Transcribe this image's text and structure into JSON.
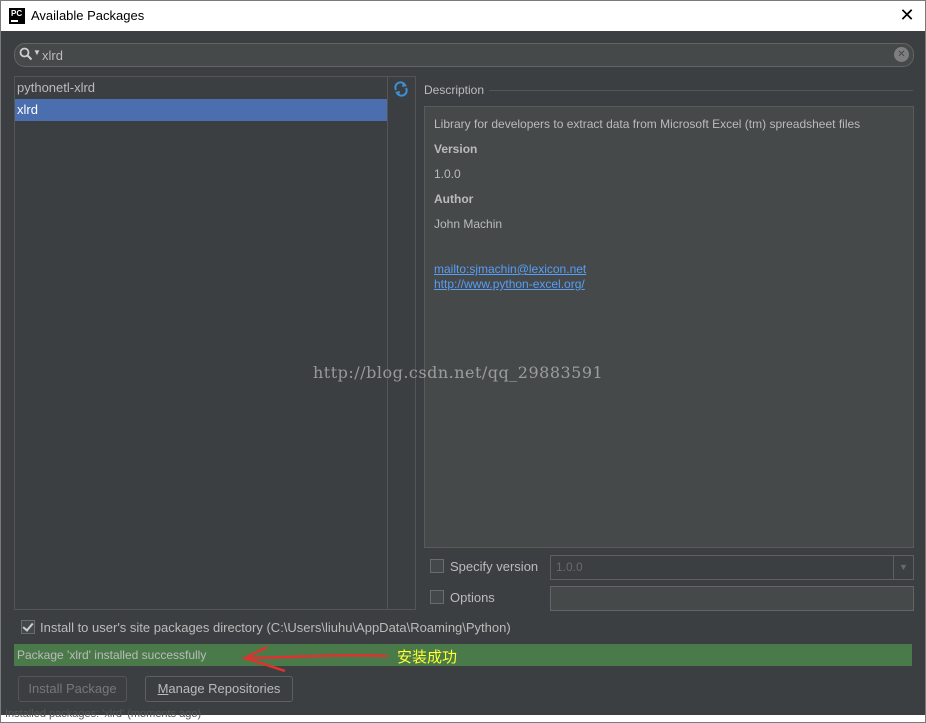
{
  "window": {
    "title": "Available Packages",
    "app_icon_text": "PC"
  },
  "search": {
    "value": "xlrd"
  },
  "packages": [
    {
      "name": "pythonetl-xlrd",
      "selected": false
    },
    {
      "name": "xlrd",
      "selected": true
    }
  ],
  "description": {
    "label": "Description",
    "summary": "Library for developers to extract data from Microsoft Excel (tm) spreadsheet files",
    "version_label": "Version",
    "version_value": "1.0.0",
    "author_label": "Author",
    "author_value": "John Machin",
    "mailto_link": "mailto:sjmachin@lexicon.net",
    "home_link": "http://www.python-excel.org/"
  },
  "options": {
    "specify_version_label": "Specify version",
    "specify_version_checked": false,
    "version_selected": "1.0.0",
    "options_label": "Options",
    "options_checked": false,
    "options_value": ""
  },
  "install_to_user": {
    "label": "Install to user's site packages directory (C:\\Users\\liuhu\\AppData\\Roaming\\Python)",
    "checked": true
  },
  "status": {
    "message": "Package 'xlrd' installed successfully",
    "annotation": "安装成功",
    "color": "#4a7a4a"
  },
  "buttons": {
    "install_label": "Install Package",
    "manage_label_mnemonic": "M",
    "manage_label_rest": "anage Repositories"
  },
  "watermark": "http://blog.csdn.net/qq_29883591",
  "bottom_text": "Installed packages: 'xlrd' (moments ago)",
  "colors": {
    "selection": "#4b6eaf",
    "link": "#589df6",
    "annotation": "#ffff33",
    "arrow": "#e03030"
  }
}
